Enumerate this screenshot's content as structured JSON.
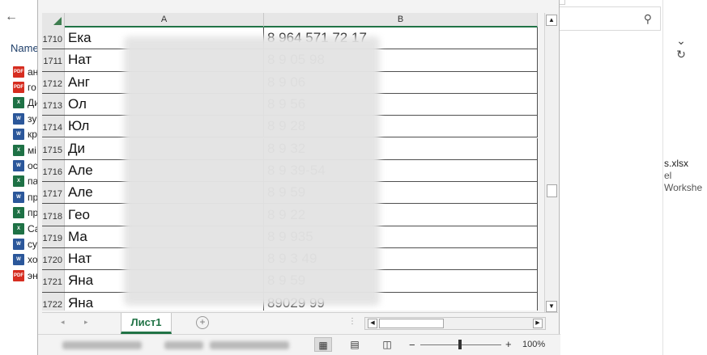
{
  "explorer": {
    "name_header": "Name",
    "files": [
      {
        "type": "pdf",
        "name": "ан"
      },
      {
        "type": "pdf",
        "name": "го"
      },
      {
        "type": "xls",
        "name": "Ди"
      },
      {
        "type": "doc",
        "name": "зу"
      },
      {
        "type": "doc",
        "name": "кр"
      },
      {
        "type": "xls",
        "name": "мі"
      },
      {
        "type": "doc",
        "name": "ос"
      },
      {
        "type": "xls",
        "name": "па"
      },
      {
        "type": "doc",
        "name": "пр"
      },
      {
        "type": "xls",
        "name": "пр"
      },
      {
        "type": "xls",
        "name": "Са"
      },
      {
        "type": "doc",
        "name": "су"
      },
      {
        "type": "doc",
        "name": "хо"
      },
      {
        "type": "pdf",
        "name": "эн"
      }
    ],
    "preview_filename": "s.xlsx",
    "preview_type": "el Workshe",
    "icons": {
      "back": "back-arrow-icon",
      "forward": "forward-arrow-icon",
      "search": "search-icon",
      "chevron": "chevron-down-icon",
      "refresh": "refresh-icon"
    }
  },
  "excel": {
    "columns": [
      "A",
      "B"
    ],
    "rows": [
      {
        "num": "1710",
        "a": "Ека",
        "b": "8 964 571 72 17"
      },
      {
        "num": "1711",
        "a": "Нат",
        "b": "8 9 05 98"
      },
      {
        "num": "1712",
        "a": "Анг",
        "b": "8 9 06"
      },
      {
        "num": "1713",
        "a": "Ол",
        "b": "8 9 56"
      },
      {
        "num": "1714",
        "a": "Юл",
        "b": "8 9 28"
      },
      {
        "num": "1715",
        "a": "Ди",
        "b": "8 9 32"
      },
      {
        "num": "1716",
        "a": "Але",
        "b": "8 9 39-54"
      },
      {
        "num": "1717",
        "a": "Але",
        "b": "8 9 59"
      },
      {
        "num": "1718",
        "a": "Гео",
        "b": "8 9 22"
      },
      {
        "num": "1719",
        "a": "Ма",
        "b": "8 9 935"
      },
      {
        "num": "1720",
        "a": "Нат",
        "b": "8 9 3 49"
      },
      {
        "num": "1721",
        "a": "Яна",
        "b": "8 9 59"
      },
      {
        "num": "1722",
        "a": "Яна",
        "b": "89029 99"
      }
    ],
    "sheet_tab": "Лист1",
    "zoom_level": "100%",
    "tab_dots": "⋮"
  }
}
